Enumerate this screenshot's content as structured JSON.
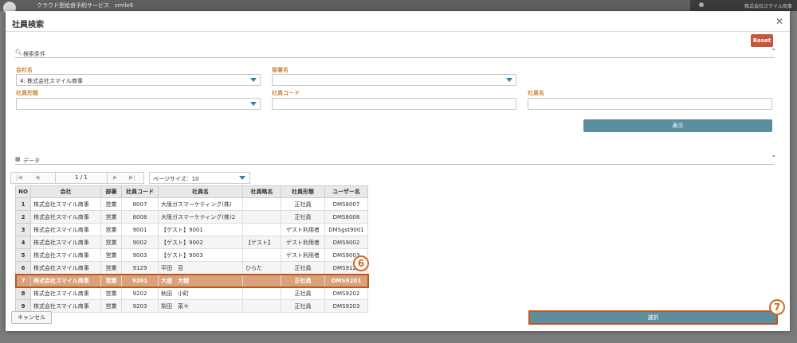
{
  "background": {
    "app_title": "クラウド型給食予約サービス　smile9",
    "company": "株式会社スマイル商事"
  },
  "dialog": {
    "title": "社員検索",
    "reset_label": "Reset",
    "search_section": "検索条件",
    "data_section": "データ",
    "show_label": "表示",
    "cancel_label": "キャンセル",
    "select_label": "選択"
  },
  "search": {
    "company": {
      "label": "会社名",
      "value": "4: 株式会社スマイル商事"
    },
    "department": {
      "label": "部署名",
      "value": ""
    },
    "employment_type": {
      "label": "社員形態",
      "value": ""
    },
    "employee_code": {
      "label": "社員コード",
      "value": ""
    },
    "employee_name": {
      "label": "社員名",
      "value": ""
    }
  },
  "pager": {
    "info": "1 / 1",
    "page_size": "ページサイズ：10"
  },
  "table": {
    "headers": [
      "NO",
      "会社",
      "部署",
      "社員コード",
      "社員名",
      "社員略名",
      "社員形態",
      "ユーザー名"
    ],
    "rows": [
      [
        "1",
        "株式会社スマイル商事",
        "営業",
        "8007",
        "大阪ガスマーケティング(株)",
        "",
        "正社員",
        "DMS8007"
      ],
      [
        "2",
        "株式会社スマイル商事",
        "営業",
        "8008",
        "大阪ガスマーケティング(株)2",
        "",
        "正社員",
        "DMS8008"
      ],
      [
        "3",
        "株式会社スマイル商事",
        "営業",
        "9001",
        "【ゲスト】9001",
        "",
        "ゲスト利用者",
        "DMSgst9001"
      ],
      [
        "4",
        "株式会社スマイル商事",
        "営業",
        "9002",
        "【ゲスト】9002",
        "【ゲスト】",
        "ゲスト利用者",
        "DMS9002"
      ],
      [
        "5",
        "株式会社スマイル商事",
        "営業",
        "9003",
        "【ゲスト】9003",
        "",
        "ゲスト利用者",
        "DMS9003"
      ],
      [
        "6",
        "株式会社スマイル商事",
        "営業",
        "9129",
        "平田　百",
        "ひらた",
        "正社員",
        "DMS9129"
      ],
      [
        "7",
        "株式会社スマイル商事",
        "営業",
        "9201",
        "大盛　大輔",
        "",
        "正社員",
        "DMS9201"
      ],
      [
        "8",
        "株式会社スマイル商事",
        "営業",
        "9202",
        "秋田　小町",
        "",
        "正社員",
        "DMS9202"
      ],
      [
        "9",
        "株式会社スマイル商事",
        "営業",
        "9203",
        "梨田　菜々",
        "",
        "正社員",
        "DMS9203"
      ]
    ],
    "selected_row": 7
  },
  "callouts": {
    "step6": "6",
    "step7": "7"
  },
  "colors": {
    "accent": "#5b8fa0",
    "reset": "#c8553d",
    "highlight": "#c0581e",
    "label": "#c98a3a"
  }
}
